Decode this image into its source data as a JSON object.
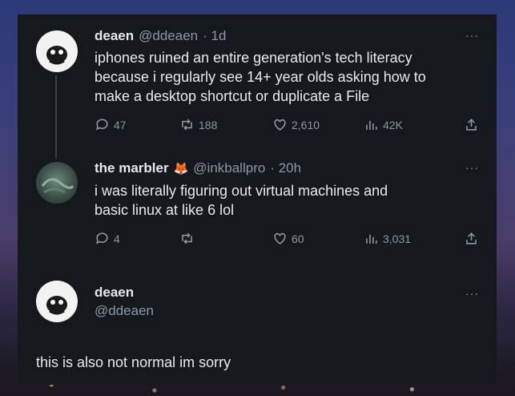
{
  "tweet1": {
    "name": "deaen",
    "handle": "@ddeaen",
    "time": "· 1d",
    "text_lines": [
      "iphones ruined an entire generation's tech literacy",
      "because i regularly see 14+ year olds asking how to",
      "make a desktop shortcut or duplicate a File"
    ],
    "replies": "47",
    "retweets": "188",
    "likes": "2,610",
    "views": "42K"
  },
  "tweet2": {
    "name": "the marbler",
    "badge": "🦊",
    "handle": "@inkballpro",
    "time": "· 20h",
    "text_lines": [
      "i was literally figuring out virtual machines and",
      "basic linux at like 6 lol"
    ],
    "replies": "4",
    "retweets": "",
    "likes": "60",
    "views": "3,031"
  },
  "tweet3": {
    "name": "deaen",
    "handle": "@ddeaen",
    "text": "this is also not normal im sorry"
  },
  "more_glyph": "···"
}
